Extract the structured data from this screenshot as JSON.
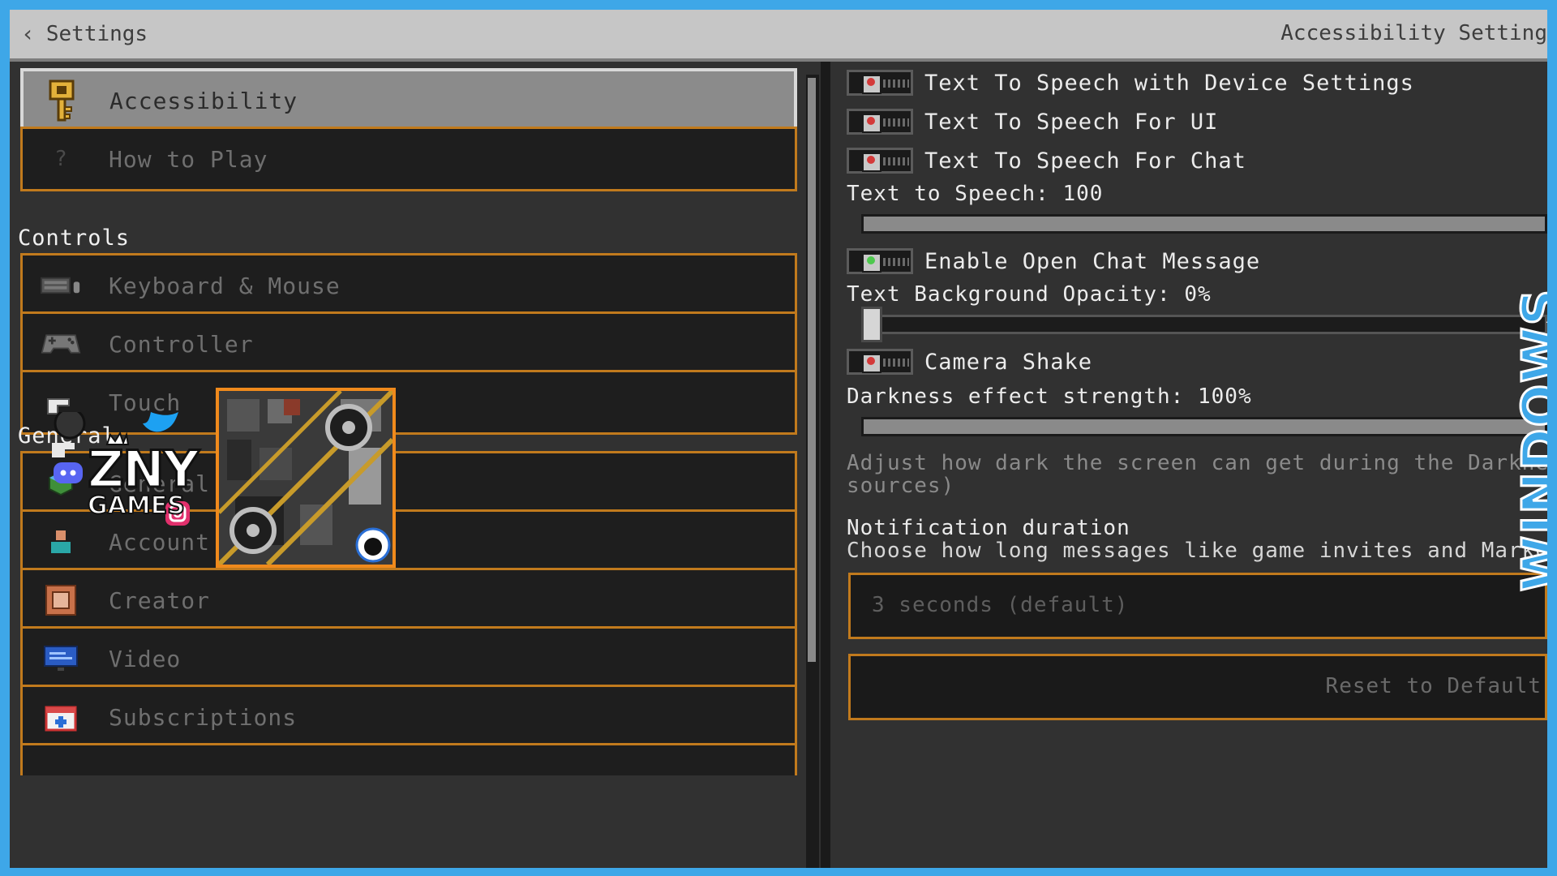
{
  "header": {
    "back_label": "Settings",
    "title": "Accessibility Setting"
  },
  "sidebar": {
    "items": [
      {
        "label": "Accessibility",
        "icon": "key-icon",
        "active": true
      },
      {
        "label": "How to Play",
        "icon": "question-icon"
      },
      {
        "label": "Keyboard & Mouse",
        "icon": "keyboard-icon"
      },
      {
        "label": "Controller",
        "icon": "gamepad-icon"
      },
      {
        "label": "Touch",
        "icon": "hand-icon"
      },
      {
        "label": "General",
        "icon": "globe-icon"
      },
      {
        "label": "Account",
        "icon": "account-icon"
      },
      {
        "label": "Creator",
        "icon": "creator-icon"
      },
      {
        "label": "Video",
        "icon": "monitor-icon"
      },
      {
        "label": "Subscriptions",
        "icon": "calendar-icon"
      }
    ],
    "sections": {
      "controls": "Controls",
      "general": "General"
    }
  },
  "settings": {
    "toggles": [
      {
        "label": "Text To Speech with Device Settings",
        "state": "off"
      },
      {
        "label": "Text To Speech For UI",
        "state": "off"
      },
      {
        "label": "Text To Speech For Chat",
        "state": "off"
      },
      {
        "label": "Enable Open Chat Message",
        "state": "on"
      },
      {
        "label": "Camera Shake",
        "state": "off"
      }
    ],
    "tts_slider_label": "Text to Speech: 100",
    "tts_level": 1.0,
    "bg_opacity_label": "Text Background Opacity: 0%",
    "bg_opacity_level": 0.0,
    "darkness_label": "Darkness effect strength: 100%",
    "darkness_level": 1.0,
    "darkness_desc_line1": "Adjust how dark the screen can get during the Darkness",
    "darkness_desc_line2": "sources)",
    "notification_heading": "Notification duration",
    "notification_desc": "Choose how long messages like game invites and Marketpla",
    "notification_value": "3 seconds (default)",
    "reset_label": "Reset to Default"
  },
  "watermark": {
    "text": "WINDOWS"
  },
  "brand": {
    "name": "ZNY",
    "sub": "GAMES"
  },
  "colors": {
    "accent_border": "#c17a1d",
    "panel_bg": "#313131",
    "header_bg": "#c6c6c6",
    "frame_bg": "#3ea7e8"
  }
}
